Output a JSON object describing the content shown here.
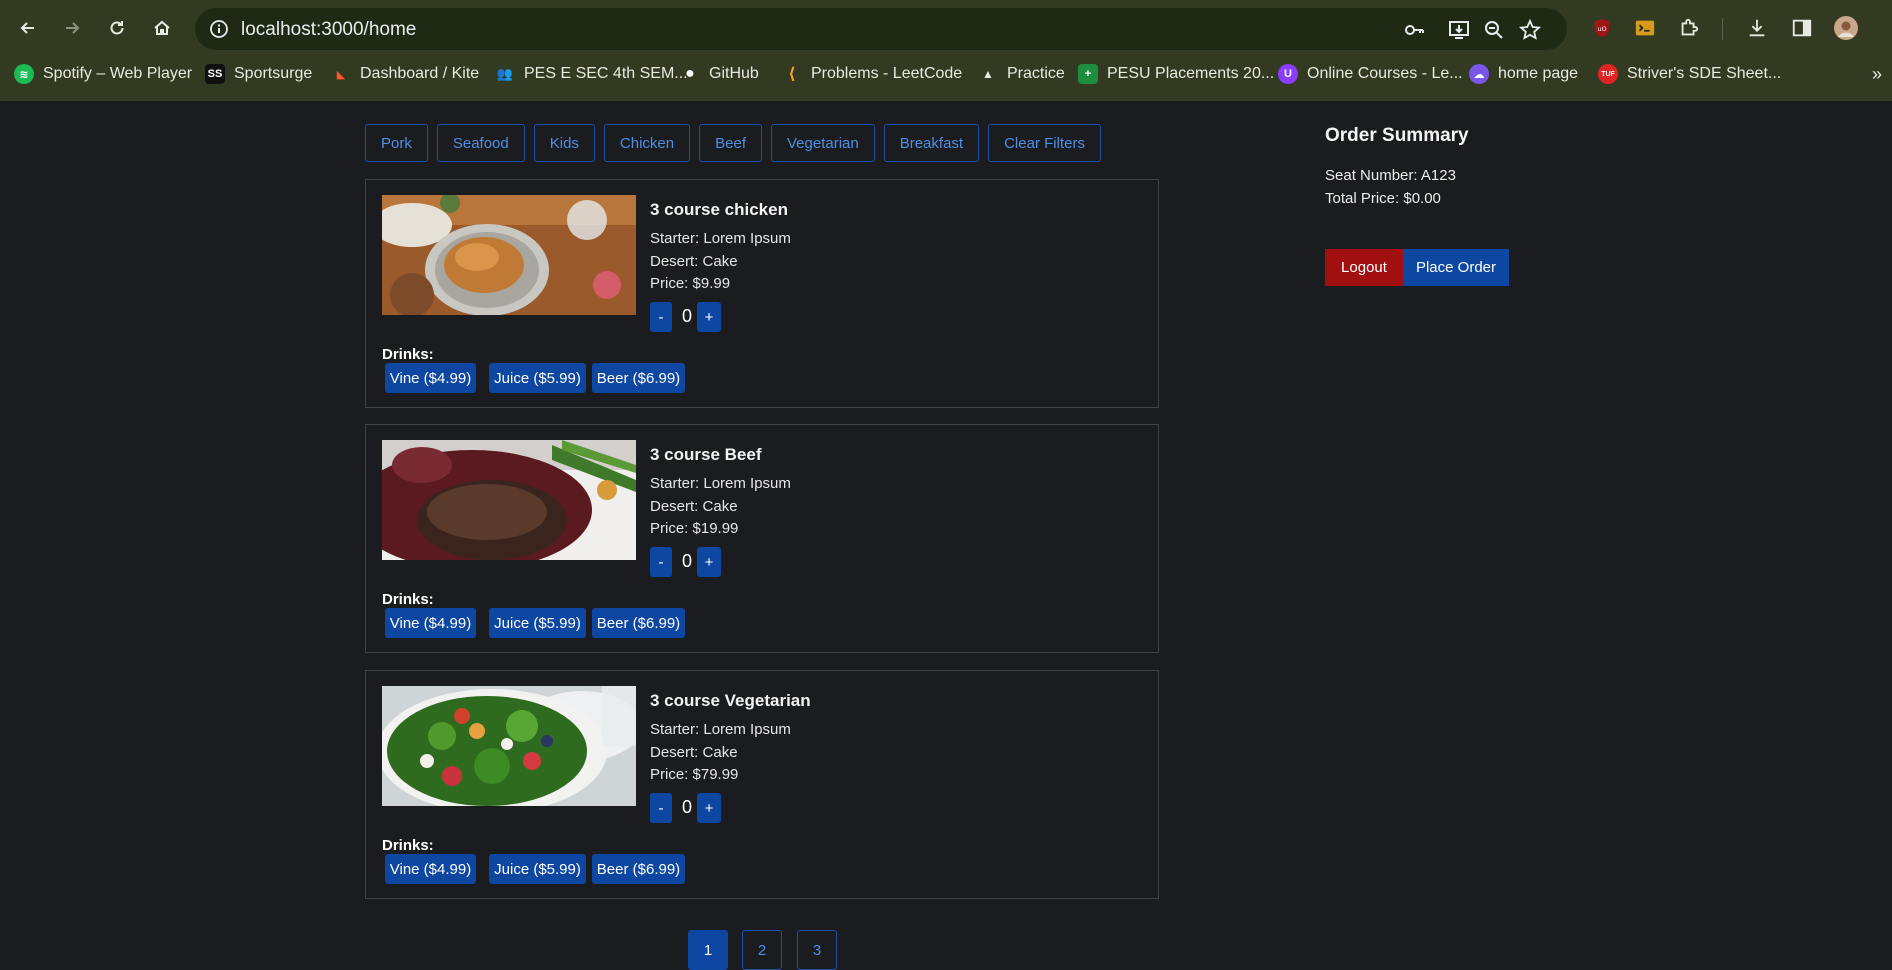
{
  "browser": {
    "url": "localhost:3000/home",
    "bookmarks": [
      {
        "label": "Spotify – Web Player",
        "icon": "spotify-icon"
      },
      {
        "label": "Sportsurge",
        "icon": "sportsurge-icon",
        "glyph": "SS"
      },
      {
        "label": "Dashboard / Kite",
        "icon": "kite-icon"
      },
      {
        "label": "PES E SEC 4th SEM...",
        "icon": "people-icon"
      },
      {
        "label": "GitHub",
        "icon": "github-icon"
      },
      {
        "label": "Problems - LeetCode",
        "icon": "leetcode-icon"
      },
      {
        "label": "Practice",
        "icon": "rocket-icon"
      },
      {
        "label": "PESU Placements 20...",
        "icon": "sheets-icon"
      },
      {
        "label": "Online Courses - Le...",
        "icon": "udemy-icon"
      },
      {
        "label": "home page",
        "icon": "cloud-icon"
      },
      {
        "label": "Striver's SDE Sheet...",
        "icon": "tuf-icon",
        "glyph": "TUF"
      }
    ],
    "bookmarks_more": "»"
  },
  "filters": [
    "Pork",
    "Seafood",
    "Kids",
    "Chicken",
    "Beef",
    "Vegetarian",
    "Breakfast",
    "Clear Filters"
  ],
  "meals": [
    {
      "title": "3 course chicken",
      "starter": "Starter: Lorem Ipsum",
      "dessert": "Desert: Cake",
      "price": "Price: $9.99",
      "quantity": "0",
      "image": "roast-chicken-photo"
    },
    {
      "title": "3 course Beef",
      "starter": "Starter: Lorem Ipsum",
      "dessert": "Desert: Cake",
      "price": "Price: $19.99",
      "quantity": "0",
      "image": "steak-photo"
    },
    {
      "title": "3 course Vegetarian",
      "starter": "Starter: Lorem Ipsum",
      "dessert": "Desert: Cake",
      "price": "Price: $79.99",
      "quantity": "0",
      "image": "salad-photo"
    }
  ],
  "drinks_label": "Drinks:",
  "drinks": [
    "Vine ($4.99)",
    "Juice ($5.99)",
    "Beer ($6.99)"
  ],
  "qty_minus": "-",
  "qty_plus": "+",
  "summary": {
    "title": "Order Summary",
    "seat": "Seat Number: A123",
    "total": "Total Price: $0.00",
    "logout": "Logout",
    "place_order": "Place Order"
  },
  "pagination": [
    "1",
    "2",
    "3"
  ],
  "colors": {
    "primary": "#0d47a1",
    "danger": "#a10f10",
    "background": "#1b1c1f",
    "link": "#4d8fe6"
  }
}
